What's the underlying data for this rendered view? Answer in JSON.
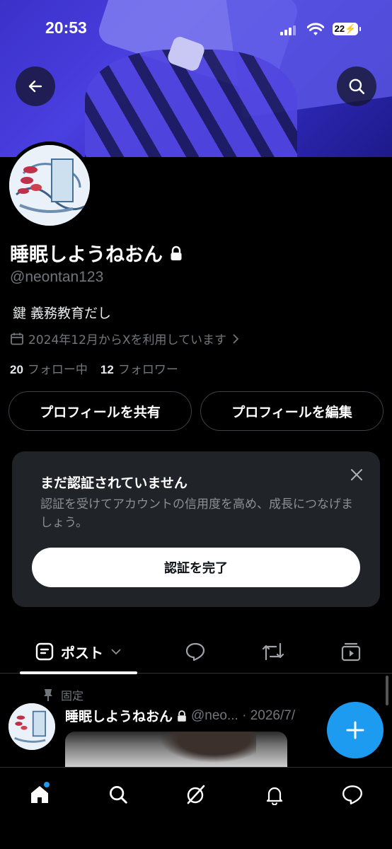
{
  "status_bar": {
    "time": "20:53",
    "battery": "22"
  },
  "profile": {
    "display_name": "睡眠しようねおん",
    "handle": "@neontan123",
    "bio": "鍵 義務教育だし",
    "joined": "2024年12月からXを利用しています",
    "following_count": "20",
    "following_label": "フォロー中",
    "followers_count": "12",
    "followers_label": "フォロワー"
  },
  "actions": {
    "share_label": "プロフィールを共有",
    "edit_label": "プロフィールを編集"
  },
  "verify_card": {
    "title": "まだ認証されていません",
    "description": "認証を受けてアカウントの信用度を高め、成長につなげましょう。",
    "button_label": "認証を完了"
  },
  "tabs": {
    "posts_label": "ポスト"
  },
  "pinned_post": {
    "pinned_label": "固定",
    "author_name": "睡眠しようねおん",
    "meta": "@neo... · 2026/7/"
  },
  "colors": {
    "accent": "#1d9bf0",
    "background": "#000000",
    "card": "#202327"
  }
}
